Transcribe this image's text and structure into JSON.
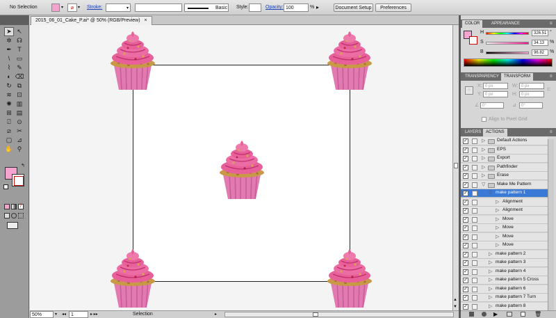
{
  "control": {
    "selection": "No Selection",
    "stroke_label": "Stroke:",
    "brush": "Basic",
    "style_label": "Style:",
    "opacity_label": "Opacity:",
    "opacity_value": "100",
    "opacity_unit": "%",
    "doc_setup": "Document Setup",
    "preferences": "Preferences"
  },
  "tools": {
    "icons": [
      "selection-tool-icon",
      "direct-selection-tool-icon",
      "magic-wand-tool-icon",
      "lasso-tool-icon",
      "pen-tool-icon",
      "type-tool-icon",
      "line-tool-icon",
      "rectangle-tool-icon",
      "paintbrush-tool-icon",
      "pencil-tool-icon",
      "blob-brush-tool-icon",
      "eraser-tool-icon",
      "rotate-tool-icon",
      "scale-tool-icon",
      "warp-tool-icon",
      "free-transform-tool-icon",
      "symbol-sprayer-tool-icon",
      "graph-tool-icon",
      "mesh-tool-icon",
      "gradient-tool-icon",
      "eyedropper-tool-icon",
      "blend-tool-icon",
      "slice-tool-icon",
      "scissors-tool-icon",
      "artboard-tool-icon",
      "ruler-tool-icon",
      "hand-tool-icon",
      "zoom-tool-icon"
    ],
    "fill_color": "#f5a3cf"
  },
  "document": {
    "tab_title": "2015_06_01_Cake_P.ai* @ 50% (RGB/Preview)",
    "close": "×"
  },
  "status": {
    "zoom": "50%",
    "artboard": "1",
    "mode": "Selection"
  },
  "color_panel": {
    "tabs": [
      "COLOR",
      "APPEARANCE"
    ],
    "h_label": "H",
    "h_value": "326.51",
    "h_unit": "°",
    "s_label": "S",
    "s_value": "34.13",
    "s_unit": "%",
    "b_label": "B",
    "b_value": "96.82",
    "b_unit": "%"
  },
  "transform_panel": {
    "tabs": [
      "TRANSPARENCY",
      "TRANSFORM"
    ],
    "x_label": "X:",
    "x_value": "0 px",
    "y_label": "Y:",
    "y_value": "0 px",
    "w_label": "W:",
    "w_value": "0 px",
    "h_label": "H:",
    "h_value": "0 px",
    "angle": "0°",
    "shear": "0°",
    "align_label": "Align to Pixel Grid"
  },
  "actions_panel": {
    "tabs": [
      "LAYERS",
      "ACTIONS"
    ],
    "rows": [
      {
        "label": "Default Actions",
        "kind": "set",
        "open": false
      },
      {
        "label": "EPS",
        "kind": "set",
        "open": false
      },
      {
        "label": "Export",
        "kind": "set",
        "open": false
      },
      {
        "label": "Pathfinder",
        "kind": "set",
        "open": false
      },
      {
        "label": "Erase",
        "kind": "set",
        "open": false
      },
      {
        "label": "Make Me Pattern",
        "kind": "set",
        "open": true
      },
      {
        "label": "make pattern 1",
        "kind": "action",
        "open": true,
        "selected": true
      },
      {
        "label": "Alignment",
        "kind": "step"
      },
      {
        "label": "Alignment",
        "kind": "step"
      },
      {
        "label": "Move",
        "kind": "step"
      },
      {
        "label": "Move",
        "kind": "step"
      },
      {
        "label": "Move",
        "kind": "step"
      },
      {
        "label": "Move",
        "kind": "step"
      },
      {
        "label": "make pattern 2",
        "kind": "action"
      },
      {
        "label": "make pattern 3",
        "kind": "action"
      },
      {
        "label": "make pattern 4",
        "kind": "action"
      },
      {
        "label": "make pattern 5 Cross",
        "kind": "action"
      },
      {
        "label": "make pattern 6",
        "kind": "action"
      },
      {
        "label": "make pattern 7 Turn",
        "kind": "action"
      },
      {
        "label": "make pattern 8",
        "kind": "action"
      }
    ]
  },
  "colors": {
    "cupcake_frosting": "#e8609a",
    "cupcake_liner": "#d05a98",
    "cupcake_crumb": "#c89a48"
  }
}
